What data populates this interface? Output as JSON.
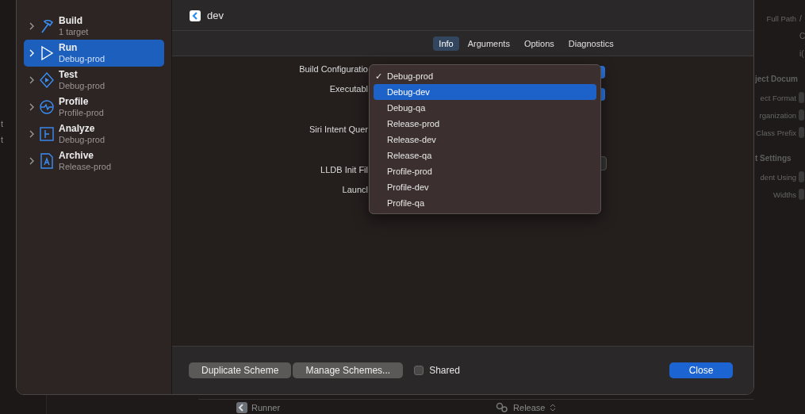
{
  "background": {
    "left_fragments": [
      "t",
      "t"
    ],
    "inspector": {
      "rows": [
        {
          "kind": "label",
          "label": "Full Path",
          "value": "/"
        },
        {
          "kind": "value",
          "label": "",
          "value": "C"
        },
        {
          "kind": "value",
          "label": "",
          "value": "i("
        },
        {
          "kind": "heading",
          "label": "ject Docum",
          "value": ""
        },
        {
          "kind": "label",
          "label": "ect Format",
          "value": ""
        },
        {
          "kind": "label",
          "label": "rganization",
          "value": ""
        },
        {
          "kind": "label",
          "label": "Class Prefix",
          "value": ""
        },
        {
          "kind": "heading",
          "label": "t Settings",
          "value": ""
        },
        {
          "kind": "label",
          "label": "dent Using",
          "value": ""
        },
        {
          "kind": "label",
          "label": "Widths",
          "value": ""
        }
      ]
    },
    "bottom_bar": {
      "target": "Runner",
      "configuration": "Release"
    }
  },
  "sheet": {
    "sidebar": {
      "items": [
        {
          "kind": "build",
          "title": "Build",
          "subtitle": "1 target",
          "selected": false
        },
        {
          "kind": "run",
          "title": "Run",
          "subtitle": "Debug-prod",
          "selected": true
        },
        {
          "kind": "test",
          "title": "Test",
          "subtitle": "Debug-prod",
          "selected": false
        },
        {
          "kind": "profile",
          "title": "Profile",
          "subtitle": "Profile-prod",
          "selected": false
        },
        {
          "kind": "analyze",
          "title": "Analyze",
          "subtitle": "Debug-prod",
          "selected": false
        },
        {
          "kind": "archive",
          "title": "Archive",
          "subtitle": "Release-prod",
          "selected": false
        }
      ]
    },
    "scheme_name": "dev",
    "tabs": [
      {
        "label": "Info",
        "selected": true
      },
      {
        "label": "Arguments",
        "selected": false
      },
      {
        "label": "Options",
        "selected": false
      },
      {
        "label": "Diagnostics",
        "selected": false
      }
    ],
    "form_labels": [
      "Build Configuratio",
      "Executabl",
      "Siri Intent Quer",
      "LLDB Init Fil",
      "Launcl"
    ],
    "menu": {
      "items": [
        {
          "label": "Debug-prod",
          "checked": true,
          "selected": false
        },
        {
          "label": "Debug-dev",
          "checked": false,
          "selected": true
        },
        {
          "label": "Debug-qa",
          "checked": false,
          "selected": false
        },
        {
          "label": "Release-prod",
          "checked": false,
          "selected": false
        },
        {
          "label": "Release-dev",
          "checked": false,
          "selected": false
        },
        {
          "label": "Release-qa",
          "checked": false,
          "selected": false
        },
        {
          "label": "Profile-prod",
          "checked": false,
          "selected": false
        },
        {
          "label": "Profile-dev",
          "checked": false,
          "selected": false
        },
        {
          "label": "Profile-qa",
          "checked": false,
          "selected": false
        }
      ],
      "check_mark": "✓"
    },
    "footer": {
      "buttons": [
        "Duplicate Scheme",
        "Manage Schemes..."
      ],
      "shared": {
        "label": "Shared",
        "checked": false
      },
      "close": "Close"
    }
  }
}
